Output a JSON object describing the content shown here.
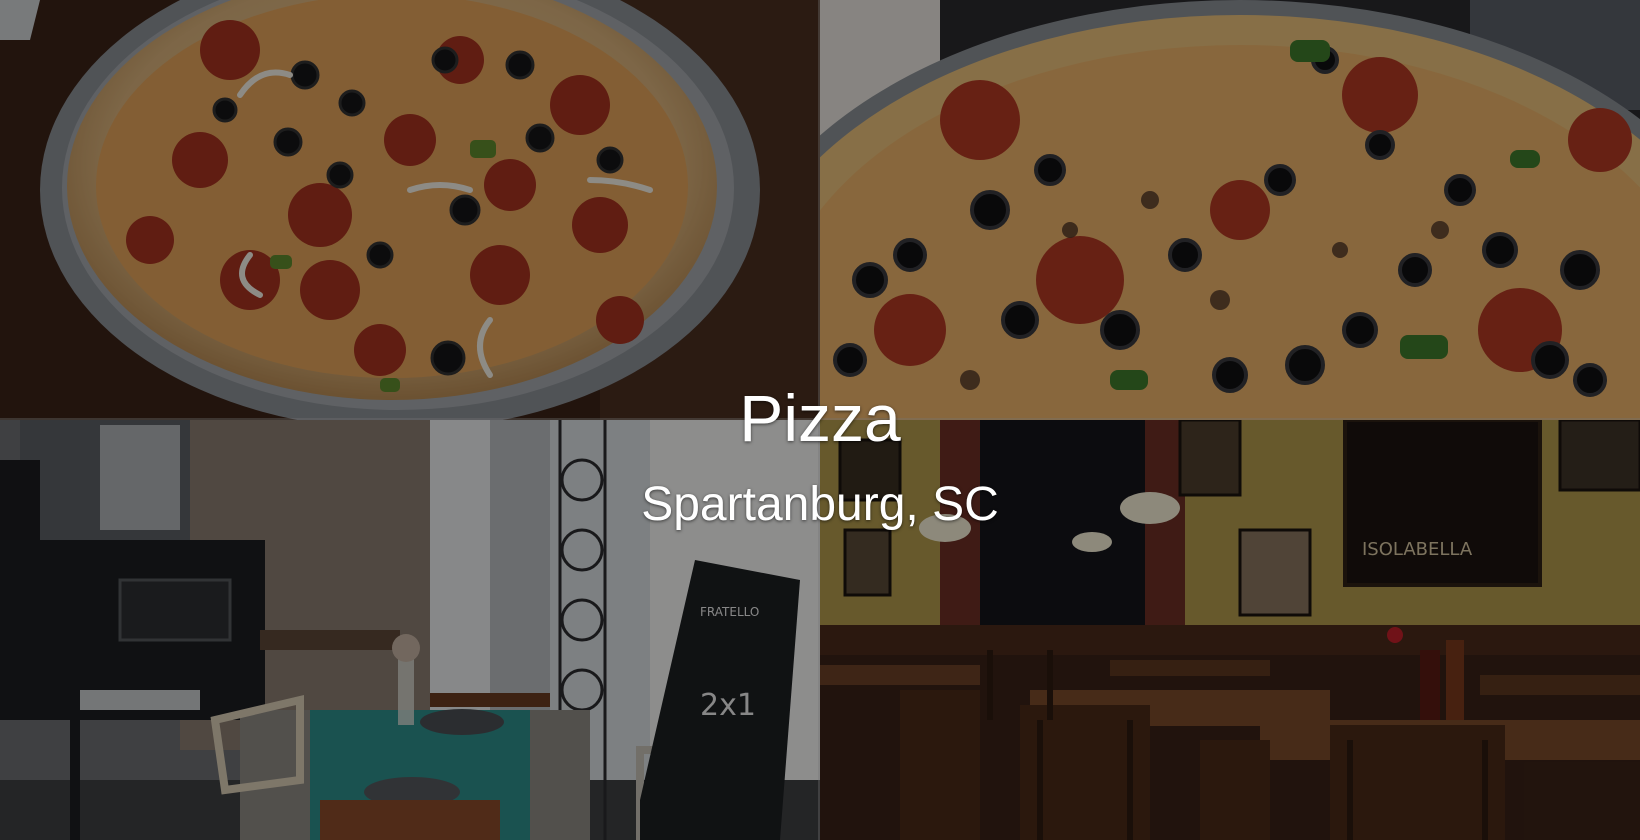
{
  "hero": {
    "title": "Pizza",
    "subtitle": "Spartanburg, SC"
  },
  "photos": [
    {
      "name": "pizza-on-tray-photo"
    },
    {
      "name": "pizza-closeup-photo"
    },
    {
      "name": "cafe-table-photo",
      "sign_brand": "FRATELLO",
      "sign_text": "2x1"
    },
    {
      "name": "restaurant-dining-room-photo",
      "poster_text": "ISOLABELLA"
    }
  ],
  "colors": {
    "overlay": "#000000",
    "text": "#ffffff",
    "wall_yellow": "#8a7434",
    "crust": "#d9b98a",
    "pepperoni": "#8e2a1c",
    "olive": "#1b1b1f"
  }
}
